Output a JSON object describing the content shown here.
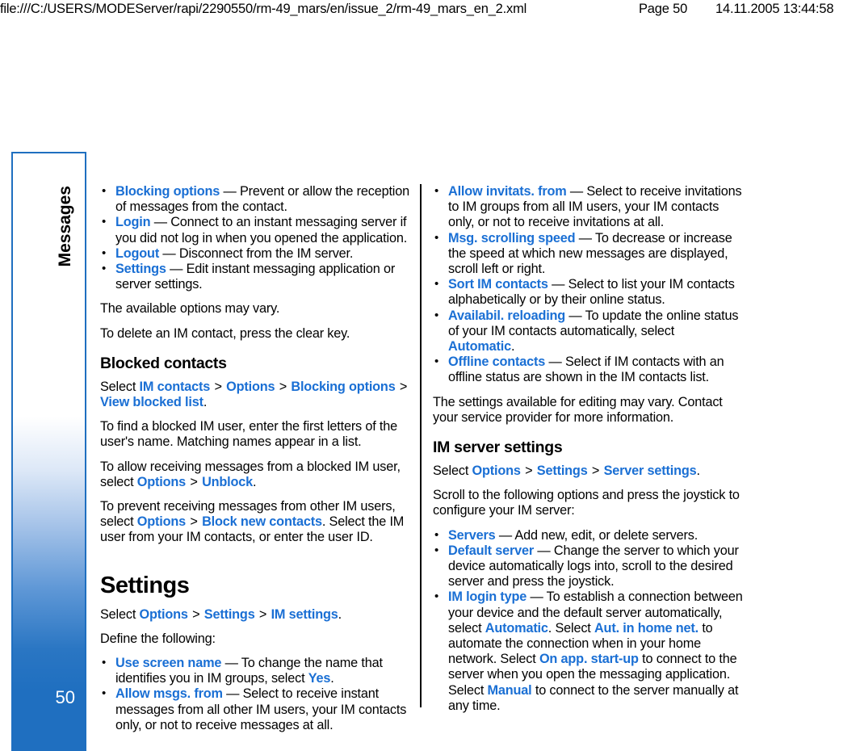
{
  "print_header": {
    "path": "file:///C:/USERS/MODEServer/rapi/2290550/rm-49_mars/en/issue_2/rm-49_mars_en_2.xml",
    "page": "Page 50",
    "datetime": "14.11.2005 13:44:58"
  },
  "side_tab": {
    "chapter_label": "Messages",
    "page_number": "50",
    "border_color": "#1f6fc0",
    "gradient_end_color": "#1f6fc0"
  },
  "theme": {
    "link_color": "#1a6fd4",
    "text_color": "#000000",
    "background": "#ffffff"
  },
  "left_column": {
    "options_list": [
      {
        "term": "Blocking options",
        "desc": " — Prevent or allow the reception of messages from the contact."
      },
      {
        "term": "Login",
        "desc": " — Connect to an instant messaging server if you did not log in when you opened the application."
      },
      {
        "term": "Logout",
        "desc": " — Disconnect from the IM server."
      },
      {
        "term": "Settings",
        "desc": " — Edit instant messaging application or server settings."
      }
    ],
    "para_vary": "The available options may vary.",
    "para_delete": "To delete an IM contact, press the clear key.",
    "blocked_heading": "Blocked contacts",
    "blocked_path": {
      "prefix": "Select ",
      "items": [
        "IM contacts",
        "Options",
        "Blocking options",
        "View blocked list"
      ],
      "separator": ">",
      "suffix": "."
    },
    "para_find": "To find a blocked IM user, enter the first letters of the user's name. Matching names appear in a list.",
    "para_allow": {
      "t1": "To allow receiving messages from a blocked IM user, select ",
      "l1": "Options",
      "sep": ">",
      "l2": "Unblock",
      "t2": "."
    },
    "para_prevent": {
      "t1": "To prevent receiving messages from other IM users, select ",
      "l1": "Options",
      "sep": ">",
      "l2": "Block new contacts",
      "t2": ". Select the IM user from your IM contacts, or enter the user ID."
    },
    "settings_heading": "Settings",
    "settings_path": {
      "prefix": "Select ",
      "items": [
        "Options",
        "Settings",
        "IM settings"
      ],
      "separator": ">",
      "suffix": "."
    },
    "define_intro": "Define the following:",
    "settings_list": [
      {
        "term": "Use screen name",
        "desc_before": " — To change the name that identifies you in IM groups, select ",
        "value": "Yes",
        "desc_after": "."
      },
      {
        "term": "Allow msgs. from",
        "desc_before": " — Select to receive instant messages from all other IM users, your IM contacts only, or not to receive messages at all.",
        "value": "",
        "desc_after": ""
      }
    ]
  },
  "right_column": {
    "settings_list": [
      {
        "term": "Allow invitats. from",
        "desc_before": " — Select to receive invitations to IM groups from all IM users, your IM contacts only, or not to receive invitations at all.",
        "value": "",
        "desc_after": ""
      },
      {
        "term": "Msg. scrolling speed",
        "desc_before": " — To decrease or increase the speed at which new messages are displayed, scroll left or right.",
        "value": "",
        "desc_after": ""
      },
      {
        "term": "Sort IM contacts",
        "desc_before": " — Select to list your IM contacts alphabetically or by their online status.",
        "value": "",
        "desc_after": ""
      },
      {
        "term": "Availabil. reloading",
        "desc_before": " — To update the online status of your IM contacts automatically, select ",
        "value": "Automatic",
        "desc_after": "."
      },
      {
        "term": "Offline contacts",
        "desc_before": " — Select if IM contacts with an offline status are shown in the IM contacts list.",
        "value": "",
        "desc_after": ""
      }
    ],
    "para_vary": "The settings available for editing may vary. Contact your service provider for more information.",
    "server_heading": "IM server settings",
    "server_path": {
      "prefix": "Select ",
      "items": [
        "Options",
        "Settings",
        "Server settings"
      ],
      "separator": ">",
      "suffix": "."
    },
    "scroll_intro": "Scroll to the following options and press the joystick to configure your IM server:",
    "server_list": [
      {
        "term": "Servers",
        "desc": " — Add new, edit, or delete servers."
      },
      {
        "term": "Default server",
        "desc": " — Change the server to which your device automatically logs into, scroll to the desired server and press the joystick."
      }
    ],
    "login_type": {
      "term": "IM login type",
      "p1": " — To establish a connection between your device and the default server automatically, select ",
      "v1": "Automatic",
      "p2": ". Select ",
      "v2": "Aut. in home net.",
      "p3": " to automate the connection when in your home network. Select ",
      "v3": "On app. start-up",
      "p4": " to connect to the server when you open the messaging application. Select ",
      "v4": "Manual",
      "p5": " to connect to the server manually at any time."
    }
  }
}
